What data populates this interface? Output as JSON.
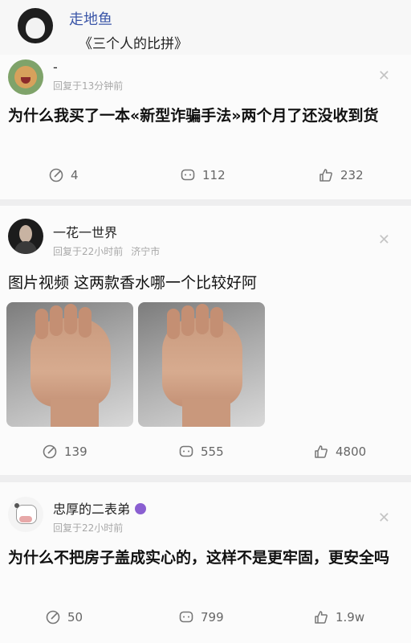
{
  "header": {
    "username": "走地鱼",
    "subtitle": "《三个人的比拼》"
  },
  "posts": [
    {
      "username": "-",
      "meta": [
        "回复于13分钟前"
      ],
      "text": "为什么我买了一本«新型诈骗手法»两个月了还没收到货",
      "edit_count": "4",
      "comment_count": "112",
      "like_count": "232"
    },
    {
      "username": "一花一世界",
      "meta": [
        "回复于22小时前",
        "济宁市"
      ],
      "text": "图片视频 这两款香水哪一个比较好阿",
      "edit_count": "139",
      "comment_count": "555",
      "like_count": "4800"
    },
    {
      "username": "忠厚的二表弟",
      "meta": [
        "回复于22小时前"
      ],
      "text": "为什么不把房子盖成实心的，这样不是更牢固，更安全吗",
      "edit_count": "50",
      "comment_count": "799",
      "like_count": "1.9w"
    }
  ],
  "icons": {
    "close": "close-icon",
    "edit": "edit-icon",
    "comment": "comment-icon",
    "like": "thumbs-up-icon"
  },
  "colors": {
    "link_name": "#3b56a8",
    "muted": "#a8a8a8",
    "verified": "#8a5fd1"
  }
}
